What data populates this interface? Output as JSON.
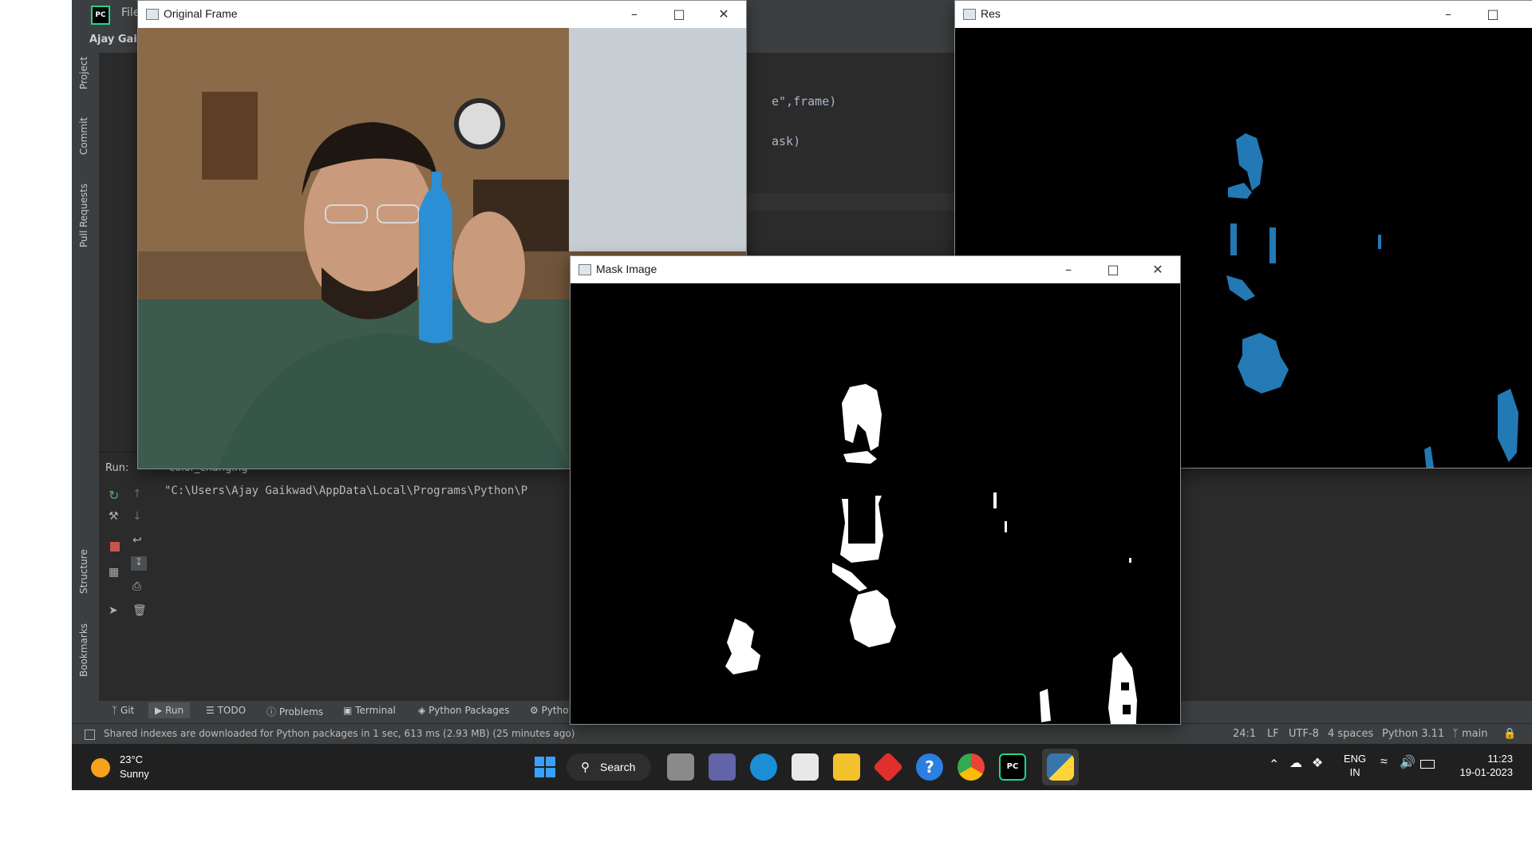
{
  "ide": {
    "menu_file": "File",
    "project_name": "Ajay Gail",
    "project_tab": "P",
    "left_tabs": [
      "Project",
      "Commit",
      "Pull Requests",
      "Structure",
      "Bookmarks"
    ],
    "code_lines": [
      "e\",frame)",
      "ask)"
    ],
    "run_label": "Run:",
    "run_config": "color_changing",
    "run_output": "\"C:\\Users\\Ajay Gaikwad\\AppData\\Local\\Programs\\Python\\P",
    "tool_tabs": [
      "Git",
      "Run",
      "TODO",
      "Problems",
      "Terminal",
      "Python Packages",
      "Pytho"
    ],
    "status_message": "Shared indexes are downloaded for Python packages in 1 sec, 613 ms (2.93 MB) (25 minutes ago)",
    "status_right": [
      "24:1",
      "LF",
      "UTF-8",
      "4 spaces",
      "Python 3.11",
      "main"
    ]
  },
  "windows": {
    "original": {
      "title": "Original Frame"
    },
    "res": {
      "title": "Res"
    },
    "mask": {
      "title": "Mask Image"
    }
  },
  "taskbar": {
    "weather_temp": "23°C",
    "weather_desc": "Sunny",
    "search_label": "Search",
    "lang_top": "ENG",
    "lang_bottom": "IN",
    "time": "11:23",
    "date": "19-01-2023"
  },
  "colors": {
    "ide_bg": "#2b2b2b",
    "taskbar_bg": "#202020",
    "bottle_blue": "#2a8fd4",
    "mask_white": "#ffffff"
  }
}
